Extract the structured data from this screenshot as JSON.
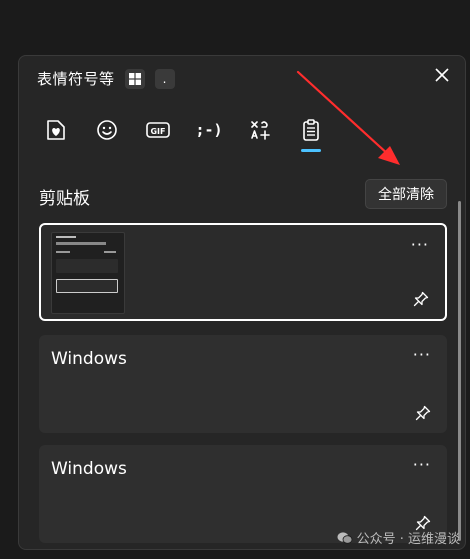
{
  "panel": {
    "title": "表情符号等",
    "shortcut_key": ".",
    "close_icon": "close-icon"
  },
  "tabs": [
    {
      "name": "favorites",
      "icon": "heart-icon",
      "selected": false
    },
    {
      "name": "emoji",
      "icon": "smiley-icon",
      "selected": false
    },
    {
      "name": "gif",
      "label": "GIF",
      "icon": "gif-icon",
      "selected": false
    },
    {
      "name": "kaomoji",
      "label": ";-)",
      "icon": "kaomoji-icon",
      "selected": false
    },
    {
      "name": "symbols",
      "icon": "symbols-icon",
      "selected": false
    },
    {
      "name": "clipboard",
      "icon": "clipboard-icon",
      "selected": true
    }
  ],
  "clipboard": {
    "title": "剪贴板",
    "clear_all_label": "全部清除",
    "items": [
      {
        "type": "image",
        "selected": true
      },
      {
        "type": "text",
        "text": "Windows",
        "selected": false
      },
      {
        "type": "text",
        "text": "Windows",
        "selected": false
      }
    ],
    "more_label": "···"
  },
  "watermark": {
    "text": "公众号 · 运维漫谈"
  },
  "colors": {
    "accent": "#4cc2ff",
    "annotation_arrow": "#ff2d2d",
    "background": "#1b1b1b",
    "panel": "#262626",
    "card": "#2f2f2f"
  }
}
